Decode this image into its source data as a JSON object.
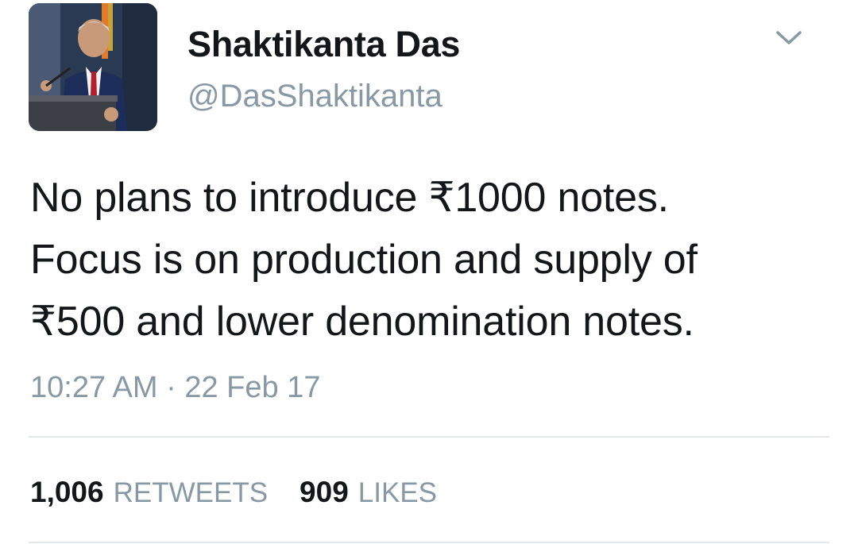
{
  "user": {
    "display_name": "Shaktikanta Das",
    "handle": "@DasShaktikanta"
  },
  "tweet": {
    "lines": [
      "No plans to introduce ₹1000 notes.",
      "Focus is on production and supply of",
      "₹500 and lower denomination notes."
    ],
    "time": "10:27 AM",
    "separator": "·",
    "date": "22 Feb 17"
  },
  "stats": {
    "retweets": {
      "count": "1,006",
      "label": "RETWEETS"
    },
    "likes": {
      "count": "909",
      "label": "LIKES"
    }
  },
  "icons": {
    "menu": "chevron-down-icon",
    "avatar": "profile-photo"
  },
  "colors": {
    "text_primary": "#14171a",
    "text_secondary": "#8899a6",
    "divider": "#e1e8ed"
  }
}
